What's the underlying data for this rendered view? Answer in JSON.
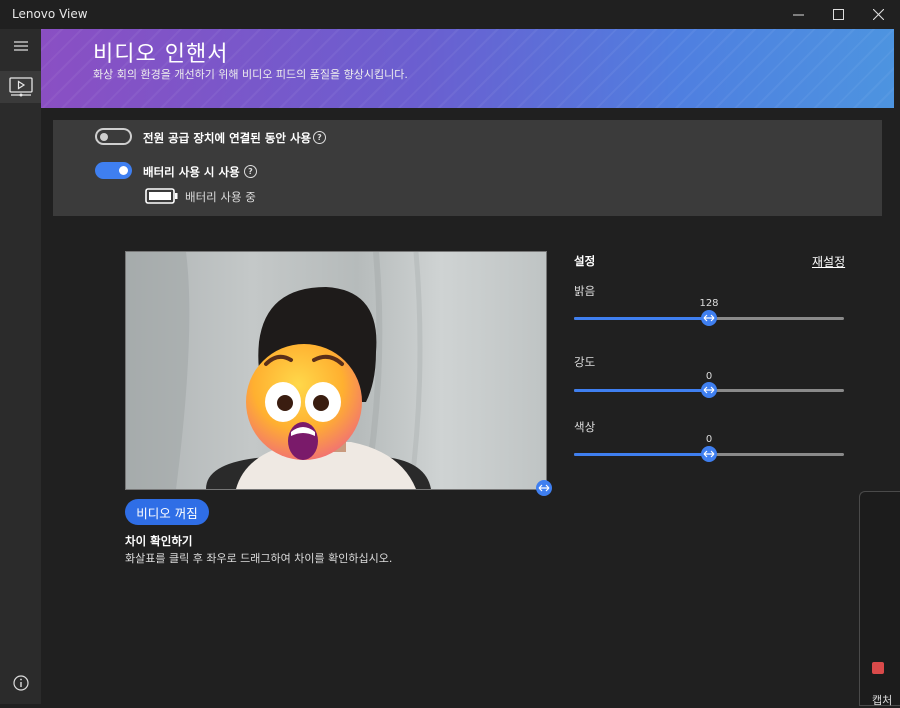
{
  "window": {
    "title": "Lenovo View"
  },
  "banner": {
    "title": "비디오 인핸서",
    "subtitle": "화상 회의 환경을 개선하기 위해 비디오 피드의 품질을 향상시킵니다."
  },
  "power": {
    "plugged": {
      "label": "전원 공급 장치에 연결된 동안 사용",
      "enabled": false
    },
    "battery": {
      "label": "배터리 사용 시 사용",
      "enabled": true
    },
    "status_text": "배터리 사용 중"
  },
  "help_glyph": "?",
  "preview": {
    "video_off_label": "비디오 꺼짐",
    "compare_title": "차이 확인하기",
    "compare_desc": "화살표를 클릭 후 좌우로 드래그하여 차이를 확인하십시오."
  },
  "settings": {
    "title": "설정",
    "reset_label": "재설정",
    "sliders": [
      {
        "label": "밝음",
        "value": "128",
        "fraction": 0.5
      },
      {
        "label": "강도",
        "value": "0",
        "fraction": 0.5
      },
      {
        "label": "색상",
        "value": "0",
        "fraction": 0.5
      }
    ]
  },
  "popup": {
    "text": "캡처"
  },
  "colors": {
    "accent": "#3f7ff0",
    "banner_start": "#8a4fc3",
    "banner_end": "#4d94e0"
  },
  "icons": [
    "hamburger-icon",
    "video-enhancer-icon",
    "info-icon",
    "minimize-icon",
    "maximize-icon",
    "close-icon",
    "help-icon",
    "battery-icon",
    "drag-arrows-icon"
  ]
}
